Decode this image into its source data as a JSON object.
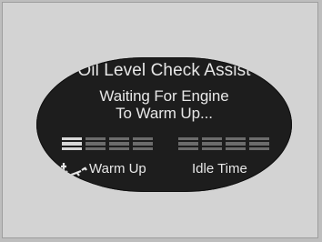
{
  "screen": {
    "title": "Oil Level Check Assist",
    "message_line1": "Waiting For Engine",
    "message_line2": "To Warm Up..."
  },
  "status": {
    "warm_up_label": "Warm Up",
    "idle_time_label": "Idle Time",
    "warm_up_progress": 0.25,
    "idle_time_progress": 0.0,
    "warm_up_icon": "oil-level-icon"
  }
}
